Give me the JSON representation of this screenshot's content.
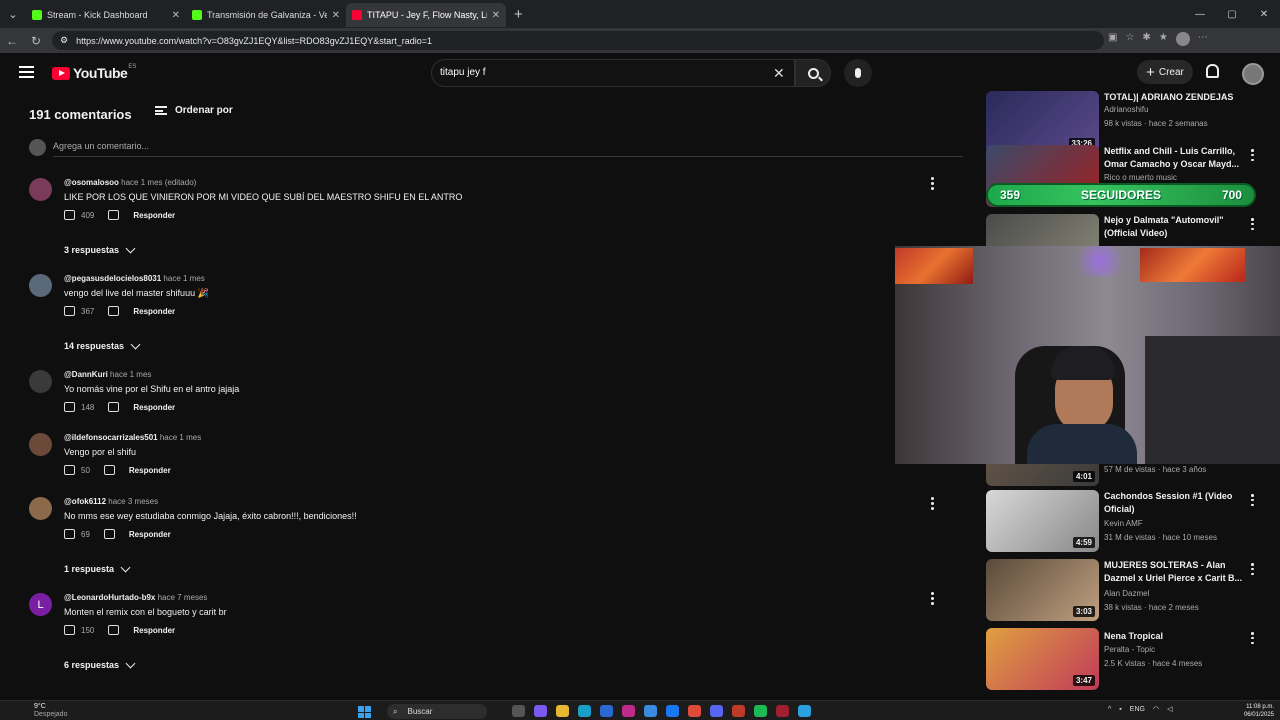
{
  "browser": {
    "tabs": [
      {
        "label": "Stream - Kick Dashboard",
        "active": false
      },
      {
        "label": "Transmisión de Galvaniza - Ver en",
        "active": false
      },
      {
        "label": "TITAPU - Jey F, Flow Nasty, Li",
        "active": true
      }
    ],
    "url": "https://www.youtube.com/watch?v=O83gvZJ1EQY&list=RDO83gvZJ1EQY&start_radio=1"
  },
  "youtube": {
    "logo_text": "YouTube",
    "country": "ES",
    "search_value": "titapu jey f",
    "create_label": "Crear"
  },
  "comments": {
    "count_title": "191 comentarios",
    "sort_label": "Ordenar por",
    "add_placeholder": "Agrega un comentario...",
    "items": [
      {
        "user": "@osomalosoo",
        "time": "hace 1 mes (editado)",
        "text": "LIKE POR LOS QUE VINIERON POR MI VIDEO QUE SUBÍ DEL MAESTRO SHIFU EN EL ANTRO",
        "likes": "409",
        "reply": "Responder",
        "replies": "3 respuestas",
        "avatar_color": "#7a3a5a"
      },
      {
        "user": "@pegasusdelocielos8031",
        "time": "hace 1 mes",
        "text": "vengo del live del master shifuuu 🎉",
        "likes": "367",
        "reply": "Responder",
        "replies": "14 respuestas",
        "avatar_color": "#5a6a7a"
      },
      {
        "user": "@DannKuri",
        "time": "hace 1 mes",
        "text": "Yo nomás vine por el Shifu en el antro jajaja",
        "likes": "148",
        "reply": "Responder",
        "replies": "",
        "avatar_color": "#3a3a3a"
      },
      {
        "user": "@ildefonsocarrizales501",
        "time": "hace 1 mes",
        "text": "Vengo por el shifu",
        "likes": "50",
        "reply": "Responder",
        "replies": "",
        "avatar_color": "#6b4a3a"
      },
      {
        "user": "@ofok6112",
        "time": "hace 3 meses",
        "text": "No mms ese wey estudiaba conmigo Jajaja, éxito cabron!!!, bendiciones!!",
        "likes": "69",
        "reply": "Responder",
        "replies": "1 respuesta",
        "avatar_color": "#8a6a4a"
      },
      {
        "user": "@LeonardoHurtado-b9x",
        "time": "hace 7 meses",
        "text": "Monten el remix con el bogueto y carit br",
        "likes": "150",
        "reply": "Responder",
        "replies": "6 respuestas",
        "avatar_color": "#7b1fa2",
        "initial": "L"
      }
    ]
  },
  "sidebar": {
    "videos": [
      {
        "title": "TOTAL)| ADRIANO ZENDEJAS",
        "channel": "Adrianoshifu",
        "meta": "98 k vistas · hace 2 semanas",
        "duration": "33:26",
        "colors": [
          "#2a2a5a",
          "#5a4a8a"
        ]
      },
      {
        "title": "Netflix and Chill - Luis Carrillo, Omar Camacho y Oscar Mayd...",
        "channel": "Rico o muerto music",
        "meta": "",
        "duration": "",
        "colors": [
          "#3a4a6a",
          "#a02020"
        ]
      },
      {
        "title": "Nejo y Dalmata \"Automovil\" (Official Video)",
        "channel": "",
        "meta": "",
        "duration": "",
        "colors": [
          "#4a4a4a",
          "#8a8a7a"
        ]
      },
      {
        "title": "",
        "channel": "",
        "meta": "57 M de vistas · hace 3 años",
        "duration": "4:01",
        "colors": [
          "#6a5a4a",
          "#3a3a3a"
        ]
      },
      {
        "title": "Cachondos Session #1 (Video Oficial)",
        "channel": "Kevin AMF",
        "meta": "31 M de vistas · hace 10 meses",
        "duration": "4:59",
        "colors": [
          "#d8d8d8",
          "#888888"
        ]
      },
      {
        "title": "MUJERES SOLTERAS - Alan Dazmel x Uriel Pierce x Carit B...",
        "channel": "Alan Dazmel",
        "meta": "38 k vistas · hace 2 meses",
        "duration": "3:03",
        "colors": [
          "#5a4a3a",
          "#c0a080"
        ]
      },
      {
        "title": "Nena Tropical",
        "channel": "Peralta - Topic",
        "meta": "2.5 K vistas · hace 4 meses",
        "duration": "3:47",
        "colors": [
          "#e0a040",
          "#c03a5a"
        ]
      }
    ]
  },
  "overlay": {
    "followers_current": "359",
    "followers_label": "SEGUIDORES",
    "followers_goal": "700"
  },
  "taskbar": {
    "temp": "9°C",
    "weather": "Despejado",
    "search": "Buscar",
    "lang": "ENG",
    "time": "11:08 p.m.",
    "date": "06/01/2025"
  }
}
